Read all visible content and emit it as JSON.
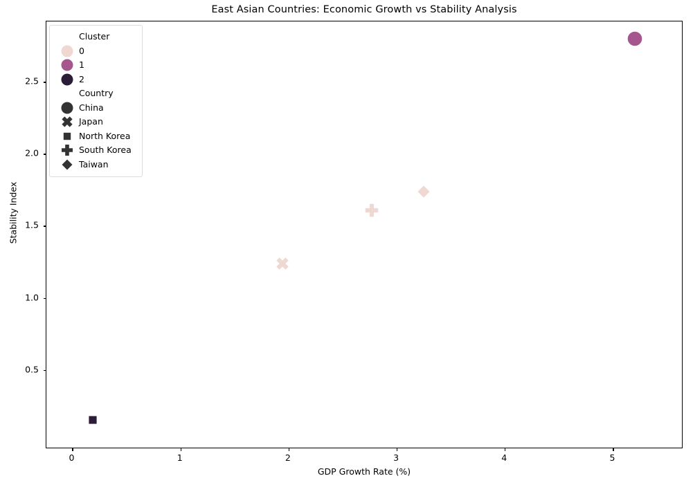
{
  "chart_data": {
    "type": "scatter",
    "title": "East Asian Countries: Economic Growth vs Stability Analysis",
    "xlabel": "GDP Growth Rate (%)",
    "ylabel": "Stability Index",
    "xlim": [
      -0.24,
      5.65
    ],
    "ylim": [
      -0.05,
      2.92
    ],
    "xticks": [
      "0",
      "1",
      "2",
      "3",
      "4",
      "5"
    ],
    "xtick_values": [
      0,
      1,
      2,
      3,
      4,
      5
    ],
    "yticks": [
      "0.5",
      "1.0",
      "1.5",
      "2.0",
      "2.5"
    ],
    "ytick_values": [
      0.5,
      1.0,
      1.5,
      2.0,
      2.5
    ],
    "grid": false,
    "legend_position": "upper left",
    "points": [
      {
        "country": "China",
        "x": 5.2,
        "y": 2.8,
        "cluster": 1,
        "marker": "circle"
      },
      {
        "country": "Taiwan",
        "x": 3.25,
        "y": 1.74,
        "cluster": 0,
        "marker": "diamond"
      },
      {
        "country": "South Korea",
        "x": 2.77,
        "y": 1.61,
        "cluster": 0,
        "marker": "plus"
      },
      {
        "country": "Japan",
        "x": 1.94,
        "y": 1.24,
        "cluster": 0,
        "marker": "x"
      },
      {
        "country": "North Korea",
        "x": 0.19,
        "y": 0.15,
        "cluster": 2,
        "marker": "square"
      }
    ],
    "cluster_colors": [
      "#efd8d2",
      "#a5578d",
      "#2b1c37"
    ],
    "marker_edge_color": "#ffffff"
  },
  "legend": {
    "sections": [
      {
        "title": "Cluster",
        "items": [
          {
            "label": "0",
            "marker": "circle",
            "color": "#efd8d2"
          },
          {
            "label": "1",
            "marker": "circle",
            "color": "#a5578d"
          },
          {
            "label": "2",
            "marker": "circle",
            "color": "#2b1c37"
          }
        ]
      },
      {
        "title": "Country",
        "items": [
          {
            "label": "China",
            "marker": "circle",
            "color": "#333333"
          },
          {
            "label": "Japan",
            "marker": "x",
            "color": "#333333"
          },
          {
            "label": "North Korea",
            "marker": "square",
            "color": "#333333"
          },
          {
            "label": "South Korea",
            "marker": "plus",
            "color": "#333333"
          },
          {
            "label": "Taiwan",
            "marker": "diamond",
            "color": "#333333"
          }
        ]
      }
    ]
  }
}
